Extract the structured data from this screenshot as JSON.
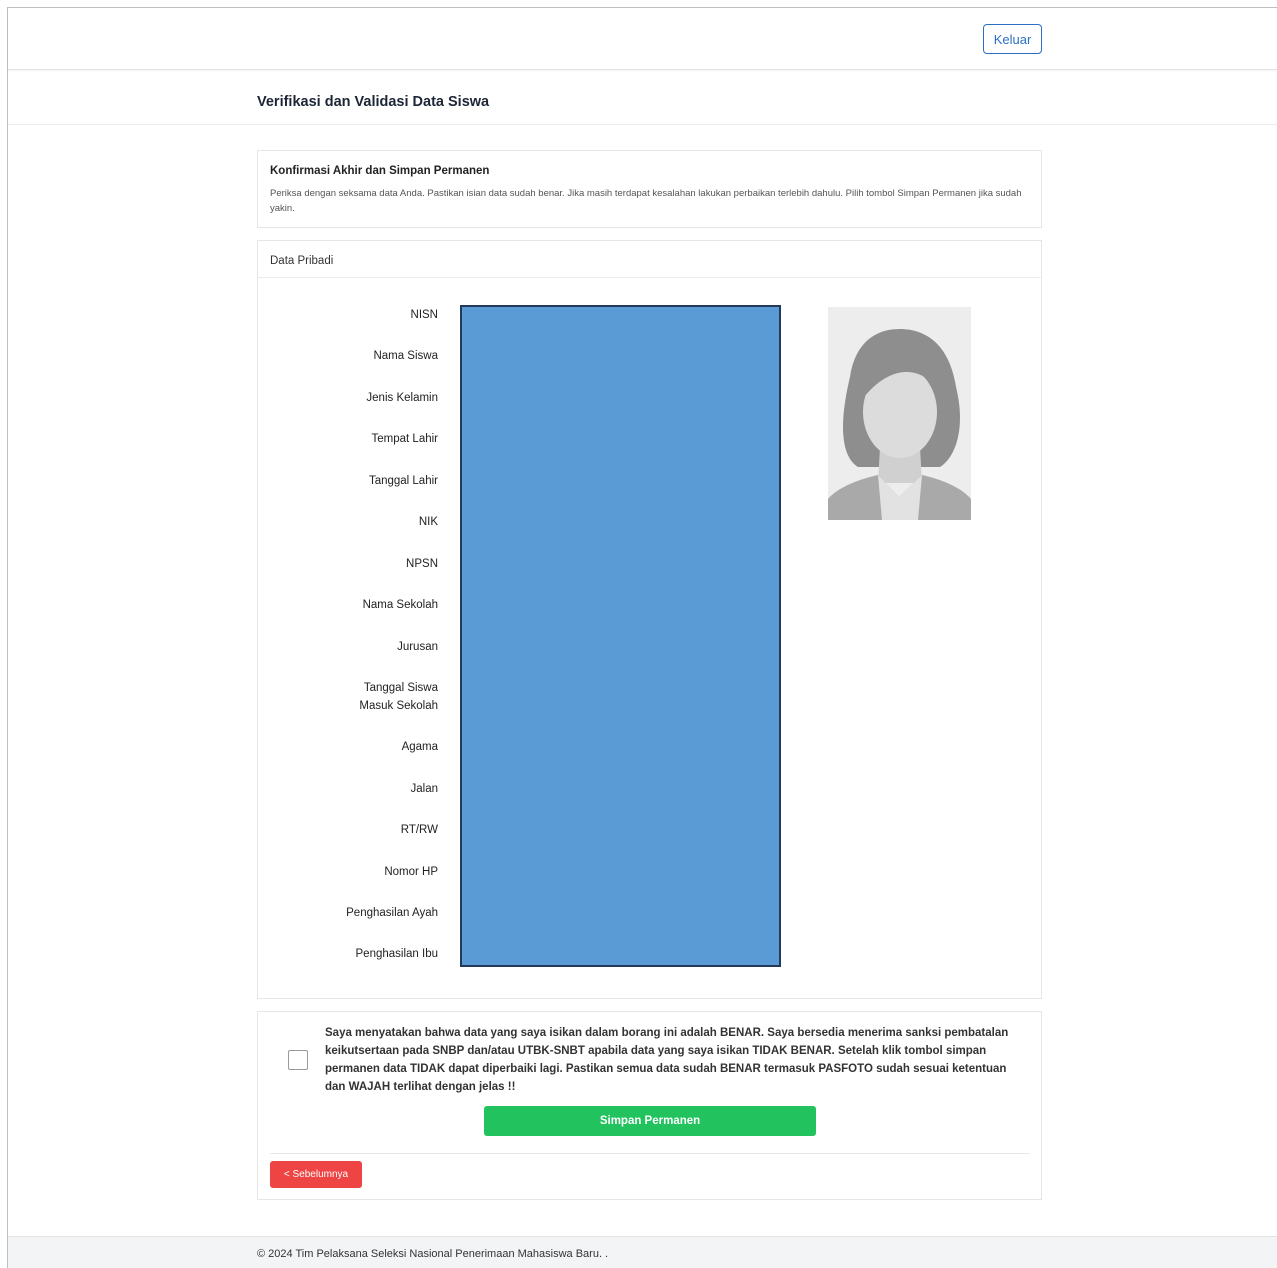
{
  "header": {
    "logout_label": "Keluar"
  },
  "page": {
    "title": "Verifikasi dan Validasi Data Siswa"
  },
  "confirmation": {
    "title": "Konfirmasi Akhir dan Simpan Permanen",
    "description": "Periksa dengan seksama data Anda. Pastikan isian data sudah benar. Jika masih terdapat kesalahan lakukan perbaikan terlebih dahulu. Pilih tombol Simpan Permanen jika sudah yakin."
  },
  "personal_data": {
    "title": "Data Pribadi",
    "fields": [
      {
        "label": "NISN"
      },
      {
        "label": "Nama Siswa"
      },
      {
        "label": "Jenis Kelamin"
      },
      {
        "label": "Tempat Lahir"
      },
      {
        "label": "Tanggal Lahir"
      },
      {
        "label": "NIK"
      },
      {
        "label": "NPSN"
      },
      {
        "label": "Nama Sekolah"
      },
      {
        "label": "Jurusan"
      },
      {
        "label": "Tanggal Siswa Masuk Sekolah"
      },
      {
        "label": "Agama"
      },
      {
        "label": "Jalan"
      },
      {
        "label": "RT/RW"
      },
      {
        "label": "Nomor HP"
      },
      {
        "label": "Penghasilan Ayah"
      },
      {
        "label": "Penghasilan Ibu"
      }
    ],
    "photo_icon": "person-silhouette-icon"
  },
  "agreement": {
    "checked": false,
    "text": "Saya menyatakan bahwa data yang saya isikan dalam borang ini adalah BENAR. Saya bersedia menerima sanksi pembatalan keikutsertaan pada SNBP dan/atau UTBK-SNBT apabila data yang saya isikan TIDAK BENAR. Setelah klik tombol simpan permanen data TIDAK dapat diperbaiki lagi. Pastikan semua data sudah BENAR termasuk PASFOTO sudah sesuai ketentuan dan WAJAH terlihat dengan jelas !!",
    "save_label": "Simpan Permanen",
    "prev_label": "< Sebelumnya"
  },
  "footer": {
    "text": "© 2024 Tim Pelaksana Seleksi Nasional Penerimaan Mahasiswa Baru.  ."
  },
  "colors": {
    "primary": "#2b6fc4",
    "success": "#22c35e",
    "danger": "#ef4444",
    "redaction": "#5b9bd5"
  }
}
